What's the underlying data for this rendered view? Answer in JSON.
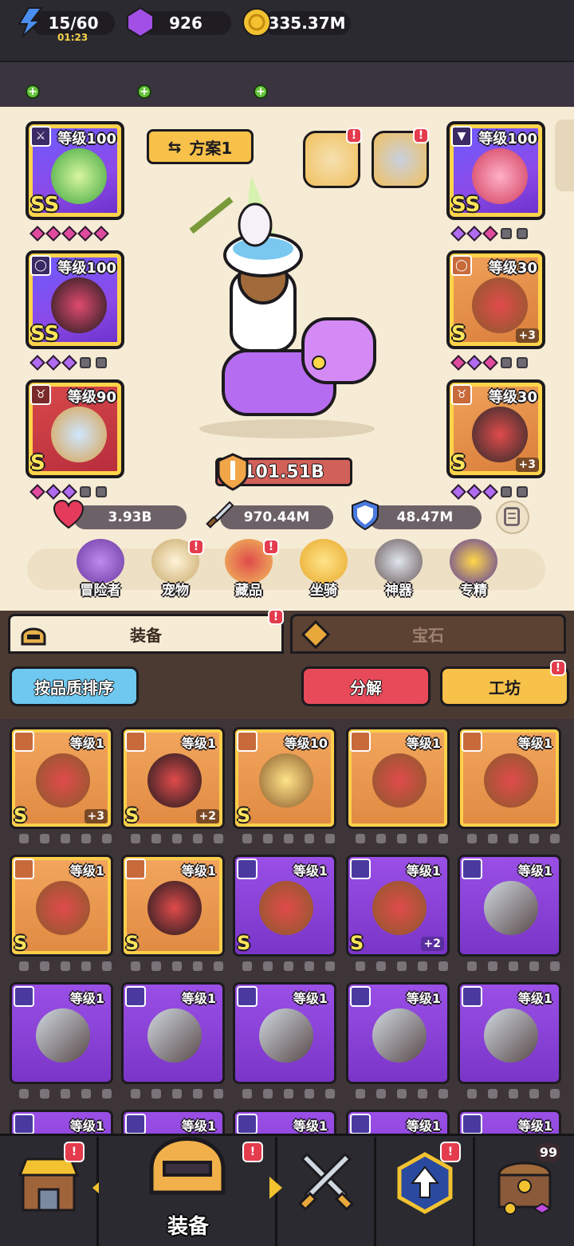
{
  "resources": {
    "energy": {
      "value": "15/60",
      "timer": "01:23",
      "icon": "energy-bolt-icon"
    },
    "gems": {
      "value": "926",
      "icon": "purple-gem-icon"
    },
    "gold": {
      "value": "335.37M",
      "icon": "gold-coin-icon"
    }
  },
  "plan": {
    "label": "方案1"
  },
  "equipped": {
    "left": [
      {
        "level": "等级100",
        "grade": "SS",
        "type": "bow"
      },
      {
        "level": "等级100",
        "grade": "SS",
        "type": "ring"
      },
      {
        "level": "等级90",
        "grade": "S",
        "type": "necklace"
      }
    ],
    "right": [
      {
        "level": "等级100",
        "grade": "SS",
        "type": "cloak"
      },
      {
        "level": "等级30",
        "grade": "S",
        "plus": "+3",
        "type": "ring"
      },
      {
        "level": "等级30",
        "grade": "S",
        "plus": "+3",
        "type": "necklace"
      }
    ]
  },
  "power": {
    "value": "101.51B"
  },
  "stats": {
    "hp": "3.93B",
    "atk": "970.44M",
    "def": "48.47M"
  },
  "menu": [
    {
      "label": "冒险者",
      "icon": "adventurer-icon",
      "alert": false
    },
    {
      "label": "宠物",
      "icon": "pet-egg-icon",
      "alert": true
    },
    {
      "label": "藏品",
      "icon": "collection-icon",
      "alert": true
    },
    {
      "label": "坐骑",
      "icon": "horseshoe-icon",
      "alert": false
    },
    {
      "label": "神器",
      "icon": "hammer-icon",
      "alert": false
    },
    {
      "label": "专精",
      "icon": "crown-icon",
      "alert": false
    }
  ],
  "tabs": {
    "equipment": "装备",
    "gems": "宝石"
  },
  "actions": {
    "sort": "按品质排序",
    "dismantle": "分解",
    "workshop": "工坊"
  },
  "inventory": [
    {
      "level": "等级1",
      "grade": "S",
      "plus": "+3",
      "rarity": "orange",
      "type": "ring"
    },
    {
      "level": "等级1",
      "grade": "S",
      "plus": "+2",
      "rarity": "orange",
      "type": "necklace"
    },
    {
      "level": "等级10",
      "grade": "S",
      "plus": "",
      "rarity": "orange",
      "type": "bow"
    },
    {
      "level": "等级1",
      "grade": "",
      "plus": "",
      "rarity": "orange",
      "type": "ring"
    },
    {
      "level": "等级1",
      "grade": "",
      "plus": "",
      "rarity": "orange",
      "type": "ring"
    },
    {
      "level": "等级1",
      "grade": "S",
      "plus": "",
      "rarity": "orange",
      "type": "ring"
    },
    {
      "level": "等级1",
      "grade": "S",
      "plus": "",
      "rarity": "orange",
      "type": "necklace"
    },
    {
      "level": "等级1",
      "grade": "S",
      "plus": "",
      "rarity": "purple",
      "type": "ring"
    },
    {
      "level": "等级1",
      "grade": "S",
      "plus": "+2",
      "rarity": "purple",
      "type": "ring"
    },
    {
      "level": "等级1",
      "grade": "",
      "plus": "",
      "rarity": "purple",
      "type": "sword"
    },
    {
      "level": "等级1",
      "grade": "",
      "plus": "",
      "rarity": "purple",
      "type": "sword"
    },
    {
      "level": "等级1",
      "grade": "",
      "plus": "",
      "rarity": "purple",
      "type": "sword"
    },
    {
      "level": "等级1",
      "grade": "",
      "plus": "",
      "rarity": "purple",
      "type": "sword"
    },
    {
      "level": "等级1",
      "grade": "",
      "plus": "",
      "rarity": "purple",
      "type": "sword"
    },
    {
      "level": "等级1",
      "grade": "",
      "plus": "",
      "rarity": "purple",
      "type": "sword"
    },
    {
      "level": "等级1",
      "grade": "",
      "plus": "",
      "rarity": "purple",
      "type": "sword"
    },
    {
      "level": "等级1",
      "grade": "",
      "plus": "",
      "rarity": "purple",
      "type": "sword"
    },
    {
      "level": "等级1",
      "grade": "",
      "plus": "",
      "rarity": "purple",
      "type": "sword"
    },
    {
      "level": "等级1",
      "grade": "",
      "plus": "",
      "rarity": "purple",
      "type": "sword"
    },
    {
      "level": "等级1",
      "grade": "",
      "plus": "",
      "rarity": "purple",
      "type": "sword"
    }
  ],
  "bottom_nav": {
    "active_label": "装备",
    "chest_count": "99"
  },
  "colors": {
    "accent": "#f7c14a",
    "alert": "#e43b4d",
    "purple_rarity": "#8c4ae8",
    "orange_rarity": "#e08a42"
  }
}
